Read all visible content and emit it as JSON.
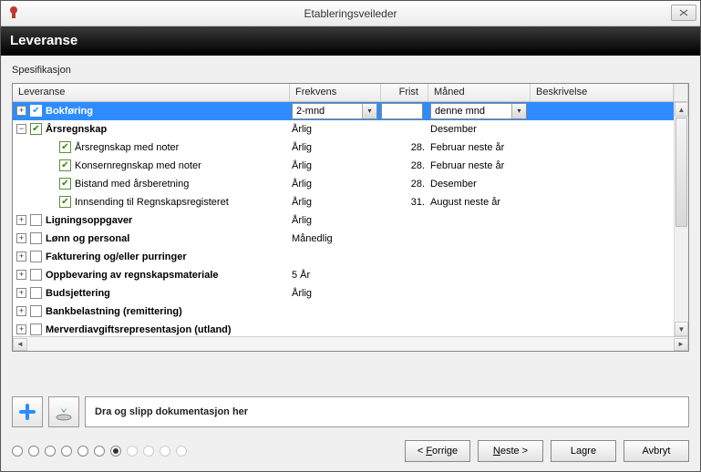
{
  "window": {
    "title": "Etableringsveileder",
    "close_tooltip": "Close"
  },
  "header": {
    "title": "Leveranse"
  },
  "section_label": "Spesifikasjon",
  "columns": {
    "leveranse": "Leveranse",
    "frekvens": "Frekvens",
    "frist": "Frist",
    "maned": "Måned",
    "beskrivelse": "Beskrivelse"
  },
  "rows": [
    {
      "level": 0,
      "expander": "+",
      "checked": true,
      "label": "Bokføring",
      "bold": true,
      "selected": true,
      "freq_combo": {
        "value": "2-mnd"
      },
      "deadline_input": "",
      "month_combo": {
        "value": "denne mnd"
      }
    },
    {
      "level": 0,
      "expander": "-",
      "checked": true,
      "label": "Årsregnskap",
      "bold": true,
      "freq_text": "Årlig",
      "deadline_text": "",
      "month_text": "Desember"
    },
    {
      "level": 1,
      "expander": "",
      "checked": true,
      "label": "Årsregnskap med noter",
      "bold": false,
      "freq_text": "Årlig",
      "deadline_text": "28.",
      "month_text": "Februar neste år"
    },
    {
      "level": 1,
      "expander": "",
      "checked": true,
      "label": "Konsernregnskap med noter",
      "bold": false,
      "freq_text": "Årlig",
      "deadline_text": "28.",
      "month_text": "Februar neste år"
    },
    {
      "level": 1,
      "expander": "",
      "checked": true,
      "label": "Bistand med årsberetning",
      "bold": false,
      "freq_text": "Årlig",
      "deadline_text": "28.",
      "month_text": "Desember"
    },
    {
      "level": 1,
      "expander": "",
      "checked": true,
      "label": "Innsending til Regnskapsregisteret",
      "bold": false,
      "freq_text": "Årlig",
      "deadline_text": "31.",
      "month_text": "August neste år"
    },
    {
      "level": 0,
      "expander": "+",
      "checked": false,
      "label": "Ligningsoppgaver",
      "bold": true,
      "freq_text": "Årlig",
      "deadline_text": "",
      "month_text": ""
    },
    {
      "level": 0,
      "expander": "+",
      "checked": false,
      "label": "Lønn og personal",
      "bold": true,
      "freq_text": "Månedlig",
      "deadline_text": "",
      "month_text": ""
    },
    {
      "level": 0,
      "expander": "+",
      "checked": false,
      "label": "Fakturering og/eller purringer",
      "bold": true,
      "freq_text": "",
      "deadline_text": "",
      "month_text": ""
    },
    {
      "level": 0,
      "expander": "+",
      "checked": false,
      "label": "Oppbevaring av regnskapsmateriale",
      "bold": true,
      "freq_text": "5 År",
      "deadline_text": "",
      "month_text": ""
    },
    {
      "level": 0,
      "expander": "+",
      "checked": false,
      "label": "Budsjettering",
      "bold": true,
      "freq_text": "Årlig",
      "deadline_text": "",
      "month_text": ""
    },
    {
      "level": 0,
      "expander": "+",
      "checked": false,
      "label": "Bankbelastning (remittering)",
      "bold": true,
      "freq_text": "",
      "deadline_text": "",
      "month_text": ""
    },
    {
      "level": 0,
      "expander": "+",
      "checked": false,
      "label": "Merverdiavgiftsrepresentasjon (utland)",
      "bold": true,
      "freq_text": "",
      "deadline_text": "",
      "month_text": ""
    }
  ],
  "dropzone": {
    "text": "Dra og slipp dokumentasjon her"
  },
  "buttons": {
    "prev": "< Forrige",
    "next": "Neste >",
    "save": "Lagre",
    "cancel": "Avbryt"
  },
  "stepper": {
    "total": 11,
    "current_index": 6,
    "enabled_until": 6
  }
}
